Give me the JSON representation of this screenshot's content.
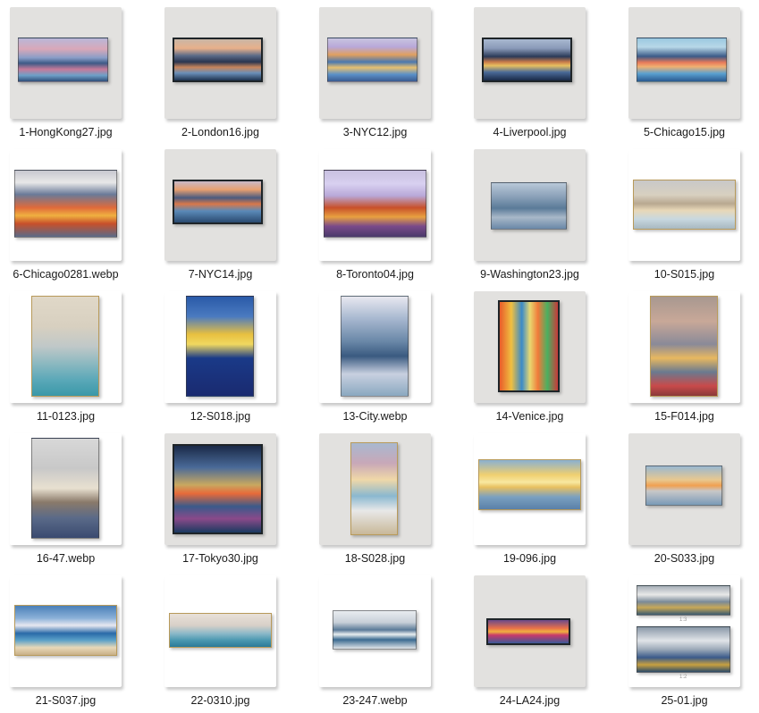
{
  "thumbnails": [
    {
      "filename": "1-HongKong27.jpg",
      "subject": "city-skyline-painting"
    },
    {
      "filename": "2-London16.jpg",
      "subject": "city-skyline-painting"
    },
    {
      "filename": "3-NYC12.jpg",
      "subject": "city-skyline-painting"
    },
    {
      "filename": "4-Liverpool.jpg",
      "subject": "city-skyline-painting"
    },
    {
      "filename": "5-Chicago15.jpg",
      "subject": "city-skyline-painting"
    },
    {
      "filename": "6-Chicago0281.webp",
      "subject": "city-skyline-painting"
    },
    {
      "filename": "7-NYC14.jpg",
      "subject": "city-skyline-painting"
    },
    {
      "filename": "8-Toronto04.jpg",
      "subject": "city-skyline-painting"
    },
    {
      "filename": "9-Washington23.jpg",
      "subject": "city-skyline-painting"
    },
    {
      "filename": "10-S015.jpg",
      "subject": "seascape-painting"
    },
    {
      "filename": "11-0123.jpg",
      "subject": "seascape-painting"
    },
    {
      "filename": "12-S018.jpg",
      "subject": "sailboat-sunset-painting"
    },
    {
      "filename": "13-City.webp",
      "subject": "abstract-city-painting"
    },
    {
      "filename": "14-Venice.jpg",
      "subject": "street-scene-painting"
    },
    {
      "filename": "15-F014.jpg",
      "subject": "seascape-flowers-painting"
    },
    {
      "filename": "16-47.webp",
      "subject": "sailing-ship-painting"
    },
    {
      "filename": "17-Tokyo30.jpg",
      "subject": "city-skyline-painting"
    },
    {
      "filename": "18-S028.jpg",
      "subject": "beach-sunset-painting"
    },
    {
      "filename": "19-096.jpg",
      "subject": "sunset-sea-painting"
    },
    {
      "filename": "20-S033.jpg",
      "subject": "sunset-sea-painting"
    },
    {
      "filename": "21-S037.jpg",
      "subject": "beach-boat-painting"
    },
    {
      "filename": "22-0310.jpg",
      "subject": "seascape-painting"
    },
    {
      "filename": "23-247.webp",
      "subject": "waves-painting"
    },
    {
      "filename": "24-LA24.jpg",
      "subject": "city-skyline-painting"
    },
    {
      "filename": "25-01.jpg",
      "subject": "landscape-diptych-painting",
      "panel_labels": [
        "1:3",
        "1:2"
      ]
    }
  ]
}
